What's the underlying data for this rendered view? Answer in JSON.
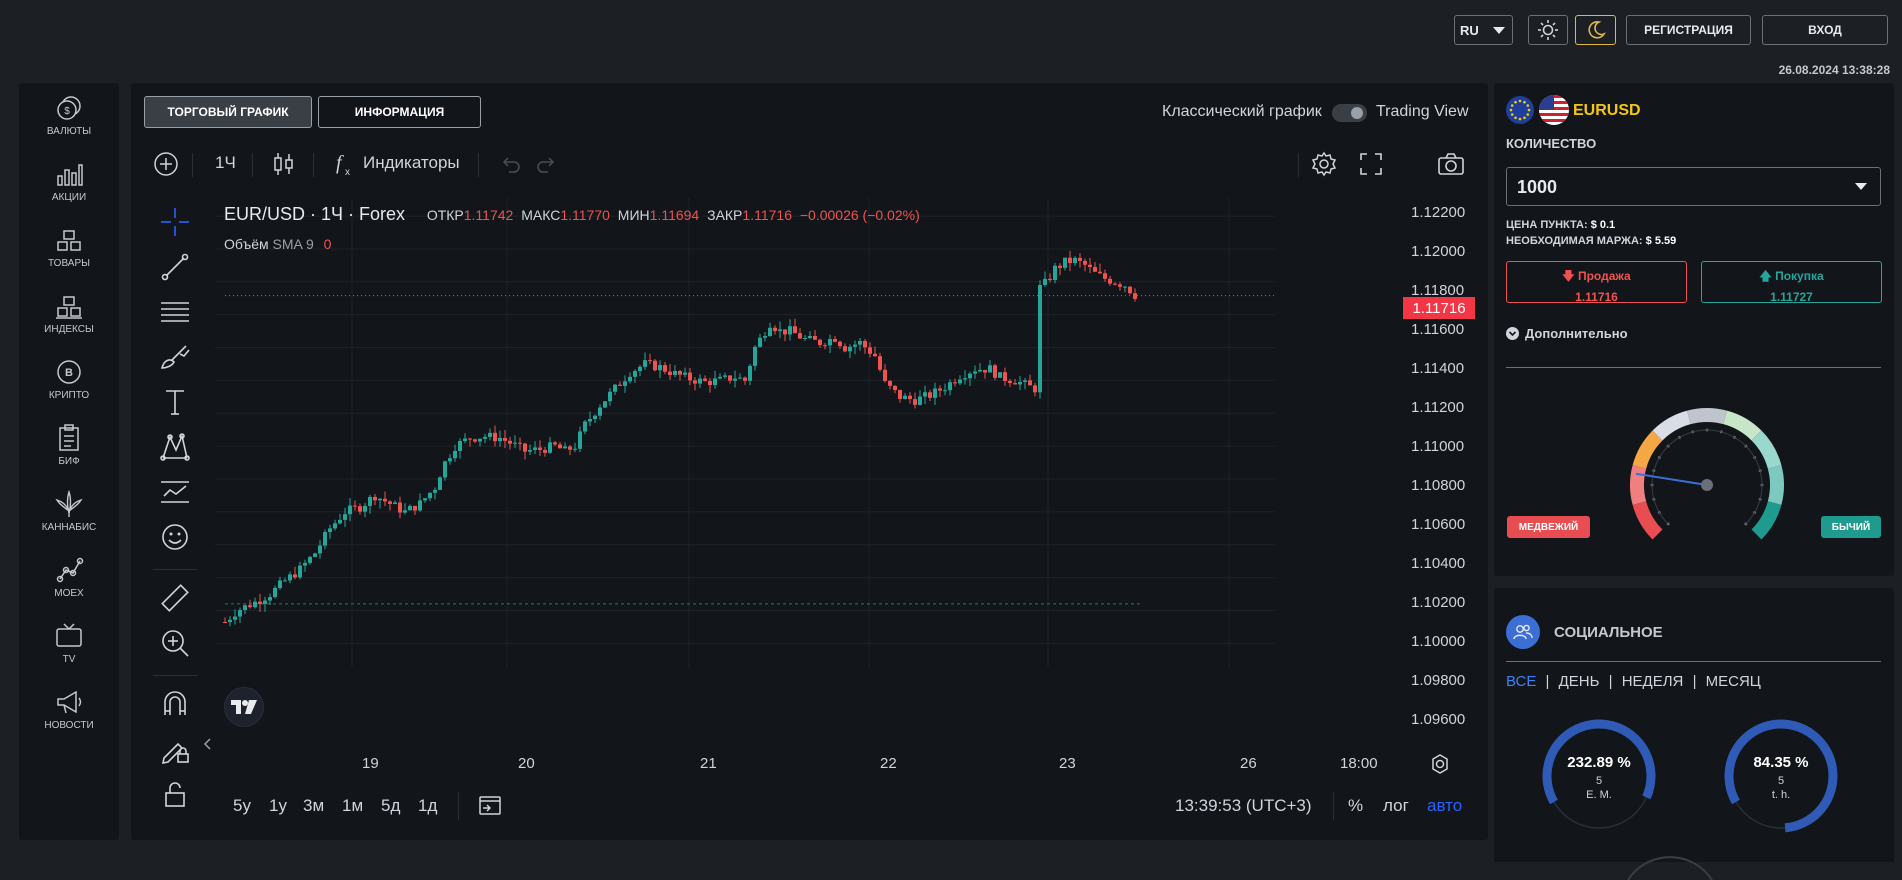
{
  "header": {
    "lang": "RU",
    "register": "РЕГИСТРАЦИЯ",
    "login": "ВХОД",
    "datetime": "26.08.2024 13:38:28"
  },
  "nav": [
    {
      "label": "ВАЛЮТЫ",
      "icon": "currency-icon"
    },
    {
      "label": "АКЦИИ",
      "icon": "stocks-icon"
    },
    {
      "label": "ТОВАРЫ",
      "icon": "commodities-icon"
    },
    {
      "label": "ИНДЕКСЫ",
      "icon": "indices-icon"
    },
    {
      "label": "КРИПТО",
      "icon": "crypto-icon"
    },
    {
      "label": "БИФ",
      "icon": "clipboard-icon"
    },
    {
      "label": "КАННАБИС",
      "icon": "cannabis-icon"
    },
    {
      "label": "MOEX",
      "icon": "moex-icon"
    },
    {
      "label": "TV",
      "icon": "tv-icon"
    },
    {
      "label": "НОВОСТИ",
      "icon": "megaphone-icon"
    }
  ],
  "tabs": {
    "chart": "ТОРГОВЫЙ ГРАФИК",
    "info": "ИНФОРМАЦИЯ"
  },
  "mode": {
    "classic": "Классический график",
    "tv": "Trading View"
  },
  "toolbar": {
    "interval": "1Ч",
    "indicators": "Индикаторы"
  },
  "legend": {
    "symbol": "EUR/USD · 1Ч · Forex",
    "open_label": "ОТКР",
    "open": "1.11742",
    "high_label": "МАКС",
    "high": "1.11770",
    "low_label": "МИН",
    "low": "1.11694",
    "close_label": "ЗАКР",
    "close": "1.11716",
    "change": "−0.00026 (−0.02%)",
    "volume_label": "Объём",
    "sma": "SMA 9",
    "volume_value": "0"
  },
  "price_label": "1.11716",
  "bottom": {
    "timeframes": [
      "5y",
      "1y",
      "3м",
      "1м",
      "5д",
      "1д"
    ],
    "time": "13:39:53 (UTC+3)",
    "percent": "%",
    "log": "лог",
    "auto": "авто"
  },
  "chart_data": {
    "type": "candlestick",
    "title": "EUR/USD · 1Ч · Forex",
    "x_ticks": [
      "19",
      "20",
      "21",
      "22",
      "23",
      "26",
      "18:00"
    ],
    "y_ticks": [
      "1.12200",
      "1.12000",
      "1.11800",
      "1.11600",
      "1.11400",
      "1.11200",
      "1.11000",
      "1.10800",
      "1.10600",
      "1.10400",
      "1.10200",
      "1.10000",
      "1.09800",
      "1.09600"
    ],
    "ylim": [
      1.0945,
      1.1231
    ],
    "last_price": 1.11716,
    "reference_line": 1.0984,
    "close_path": [
      [
        0,
        1.0973
      ],
      [
        12,
        1.098
      ],
      [
        30,
        1.0985
      ],
      [
        45,
        1.099
      ],
      [
        60,
        1.0998
      ],
      [
        75,
        1.1005
      ],
      [
        90,
        1.1015
      ],
      [
        105,
        1.103
      ],
      [
        120,
        1.104
      ],
      [
        135,
        1.1043
      ],
      [
        150,
        1.105
      ],
      [
        165,
        1.1045
      ],
      [
        180,
        1.104
      ],
      [
        195,
        1.1045
      ],
      [
        210,
        1.1055
      ],
      [
        218,
        1.1068
      ],
      [
        230,
        1.108
      ],
      [
        245,
        1.1085
      ],
      [
        260,
        1.1086
      ],
      [
        275,
        1.1085
      ],
      [
        285,
        1.1082
      ],
      [
        300,
        1.1077
      ],
      [
        315,
        1.1078
      ],
      [
        330,
        1.108
      ],
      [
        340,
        1.1077
      ],
      [
        350,
        1.108
      ],
      [
        360,
        1.1093
      ],
      [
        375,
        1.1105
      ],
      [
        390,
        1.1115
      ],
      [
        405,
        1.1125
      ],
      [
        420,
        1.113
      ],
      [
        435,
        1.1128
      ],
      [
        450,
        1.1124
      ],
      [
        465,
        1.1121
      ],
      [
        480,
        1.1119
      ],
      [
        495,
        1.112
      ],
      [
        510,
        1.1122
      ],
      [
        520,
        1.112
      ],
      [
        530,
        1.114
      ],
      [
        545,
        1.1155
      ],
      [
        555,
        1.115
      ],
      [
        565,
        1.115
      ],
      [
        580,
        1.1145
      ],
      [
        595,
        1.1143
      ],
      [
        610,
        1.1146
      ],
      [
        620,
        1.114
      ],
      [
        635,
        1.1143
      ],
      [
        650,
        1.1135
      ],
      [
        660,
        1.1118
      ],
      [
        675,
        1.111
      ],
      [
        690,
        1.1108
      ],
      [
        705,
        1.1111
      ],
      [
        720,
        1.1116
      ],
      [
        735,
        1.1123
      ],
      [
        750,
        1.1127
      ],
      [
        765,
        1.1127
      ],
      [
        775,
        1.1122
      ],
      [
        790,
        1.112
      ],
      [
        805,
        1.1116
      ],
      [
        810,
        1.1115
      ],
      [
        812,
        1.1175
      ],
      [
        822,
        1.118
      ],
      [
        830,
        1.1188
      ],
      [
        840,
        1.1192
      ],
      [
        850,
        1.1193
      ],
      [
        860,
        1.119
      ],
      [
        870,
        1.1185
      ],
      [
        880,
        1.1182
      ],
      [
        890,
        1.118
      ],
      [
        900,
        1.1178
      ],
      [
        910,
        1.1172
      ]
    ]
  },
  "trade": {
    "symbol": "EURUSD",
    "qty_label": "КОЛИЧЕСТВО",
    "qty": "1000",
    "point_price_label": "ЦЕНА ПУНКТА:",
    "point_price": "$ 0.1",
    "margin_label": "НЕОБХОДИМАЯ МАРЖА:",
    "margin": "$ 5.59",
    "sell_label": "Продажа",
    "sell_price": "1.11716",
    "buy_label": "Покупка",
    "buy_price": "1.11727",
    "more": "Дополнительно",
    "bear": "МЕДВЕЖИЙ",
    "bull": "БЫЧИЙ",
    "gauge_level": 0.2
  },
  "social": {
    "title": "СОЦИАЛЬНОЕ",
    "filters": [
      "ВСЕ",
      "ДЕНЬ",
      "НЕДЕЛЯ",
      "МЕСЯЦ"
    ],
    "stats": [
      {
        "value": "232.89 %",
        "count": "5",
        "unit": "E. M.",
        "fraction": 0.65
      },
      {
        "value": "84.35 %",
        "count": "5",
        "unit": "t. h.",
        "fraction": 0.82
      }
    ]
  },
  "colors": {
    "up": "#26a69a",
    "down": "#ef5350",
    "accent": "#2962ff"
  }
}
